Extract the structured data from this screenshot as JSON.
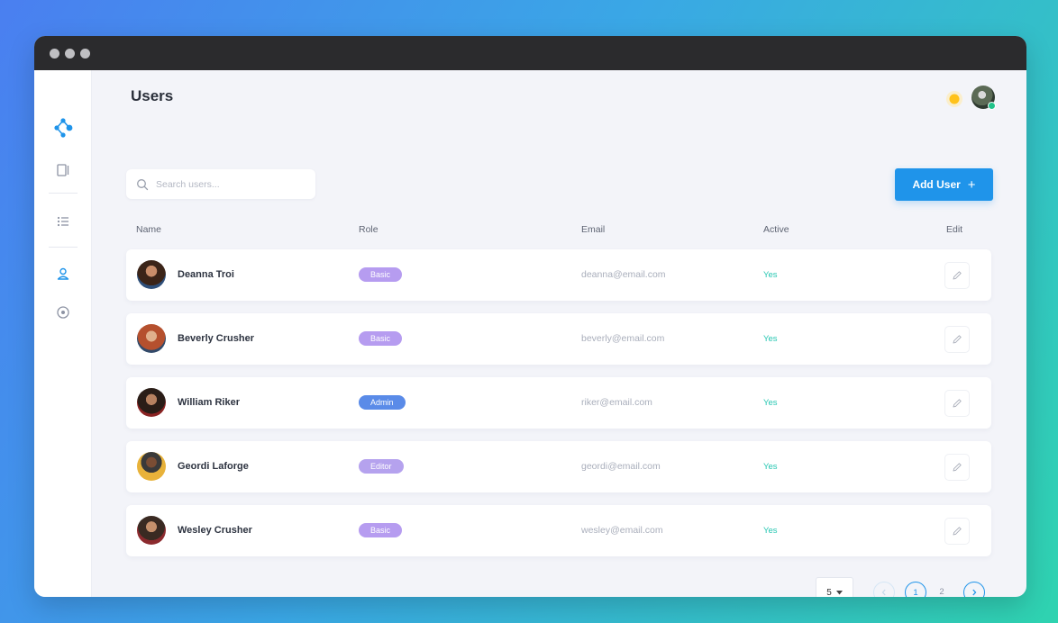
{
  "page": {
    "title": "Users"
  },
  "search": {
    "placeholder": "Search users..."
  },
  "toolbar": {
    "add_user_label": "Add User",
    "add_user_icon": "+"
  },
  "table": {
    "columns": [
      "Name",
      "Role",
      "Email",
      "Active",
      "Edit"
    ],
    "rows": [
      {
        "name": "Deanna Troi",
        "role": "Basic",
        "email": "deanna@email.com",
        "active": "Yes"
      },
      {
        "name": "Beverly Crusher",
        "role": "Basic",
        "email": "beverly@email.com",
        "active": "Yes"
      },
      {
        "name": "William Riker",
        "role": "Admin",
        "email": "riker@email.com",
        "active": "Yes"
      },
      {
        "name": "Geordi Laforge",
        "role": "Editor",
        "email": "geordi@email.com",
        "active": "Yes"
      },
      {
        "name": "Wesley Crusher",
        "role": "Basic",
        "email": "wesley@email.com",
        "active": "Yes"
      }
    ]
  },
  "pagination": {
    "page_size": "5",
    "pages": [
      "1",
      "2"
    ],
    "current_page": "1"
  },
  "colors": {
    "accent": "#1f94ea",
    "role_basic": "#b69cf0",
    "role_admin": "#5a8be8",
    "role_editor": "#b5a2ee",
    "active_text": "#27c7b2"
  },
  "icons": {
    "sidebar": [
      "app-logo-icon",
      "panel-icon",
      "list-icon",
      "user-icon",
      "record-icon"
    ],
    "row_edit": "pencil-icon"
  }
}
